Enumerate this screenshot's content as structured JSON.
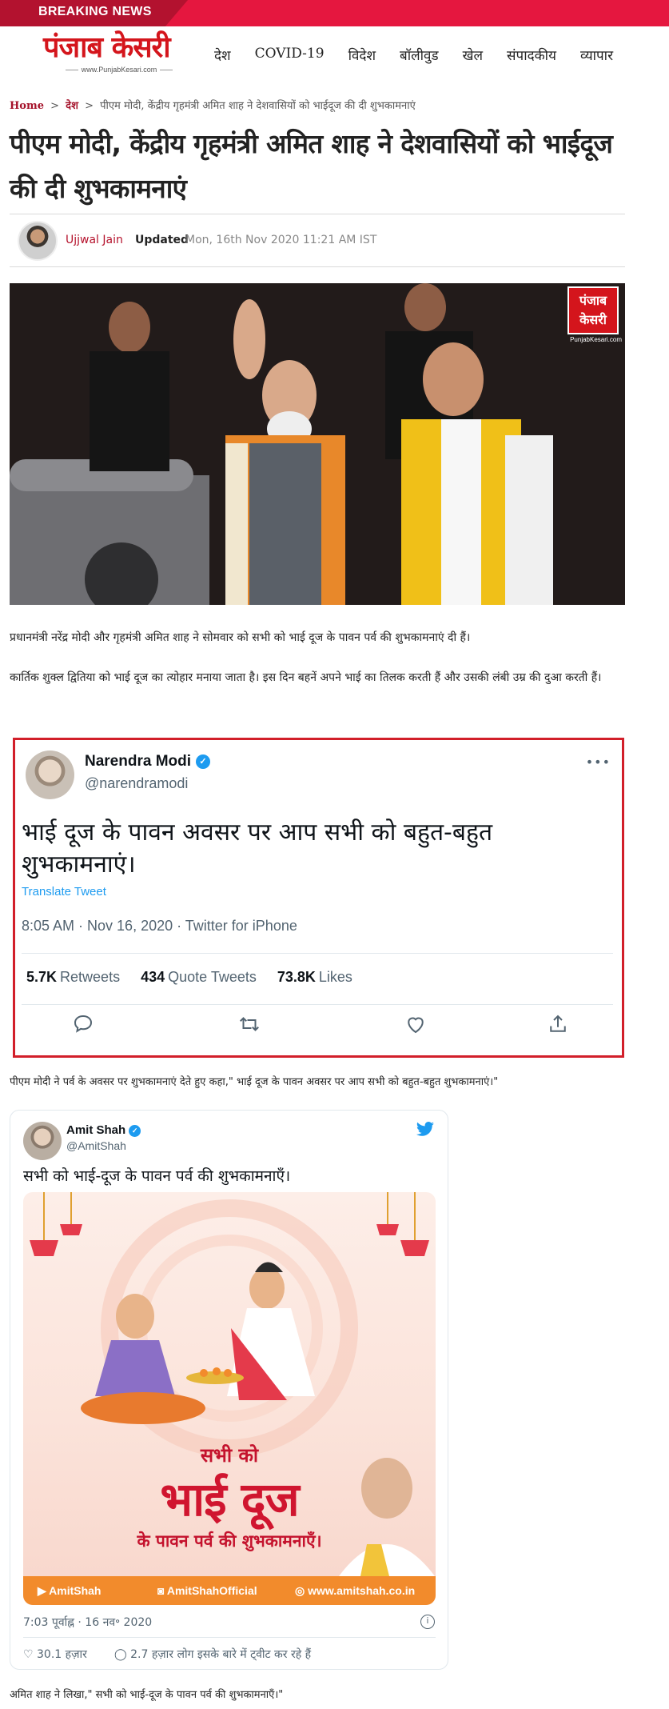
{
  "breaking": {
    "label": "BREAKING NEWS"
  },
  "header": {
    "logo_text": "पंजाब केसरी",
    "logo_sub": "www.PunjabKesari.com",
    "nav": [
      "देश",
      "COVID-19",
      "विदेश",
      "बॉलीवुड",
      "खेल",
      "संपादकीय",
      "व्यापार"
    ]
  },
  "breadcrumb": {
    "home": "Home",
    "section": "देश",
    "current": "पीएम मोदी, केंद्रीय गृहमंत्री अमित शाह ने देशवासियों को भाईदूज की दी शुभकामनाएं",
    "separator": ">"
  },
  "article": {
    "title": "पीएम मोदी, केंद्रीय गृहमंत्री अमित शाह ने देशवासियों को भाईदूज की दी शुभकामनाएं",
    "author": "Ujjwal Jain",
    "updated_label": "Updated",
    "updated_date": "Mon, 16th Nov 2020 11:21 AM IST",
    "hero_logo": "पंजाब केसरी",
    "hero_logo_sub": "PunjabKesari.com",
    "para1": "प्रधानमंत्री नरेंद्र मोदी और गृहमंत्री अमित शाह ने सोमवार को सभी को भाई दूज के पावन पर्व की शुभकामनाएं दी हैं।",
    "para2": "कार्तिक शुक्ल द्वितिया को भाई दूज का त्योहार मनाया जाता है। इस दिन बहनें अपने भाई का तिलक करती हैं और उसकी लंबी उम्र की दुआ करती हैं।",
    "caption1": "पीएम  मोदी ने पर्व के अवसर पर शुभकामनाएं देते हुए कहा,\" भाई दूज के पावन अवसर पर आप सभी को बहुत-बहुत शुभकामनाएं।\"",
    "caption2": "अमित शाह ने लिखा,\" सभी को भाई-दूज के पावन पर्व की शुभकामनाएँ।\""
  },
  "tweet_modi": {
    "name": "Narendra Modi",
    "handle": "@narendramodi",
    "verified_glyph": "✓",
    "more": "•••",
    "text": "भाई दूज के पावन अवसर पर आप सभी को बहुत-बहुत शुभकामनाएं।",
    "translate": "Translate Tweet",
    "meta": "8:05 AM · Nov 16, 2020 · Twitter for iPhone",
    "retweets_count": "5.7K",
    "retweets_label": "Retweets",
    "quotes_count": "434",
    "quotes_label": "Quote Tweets",
    "likes_count": "73.8K",
    "likes_label": "Likes",
    "actions": [
      "reply-icon",
      "retweet-icon",
      "like-icon",
      "share-icon"
    ]
  },
  "tweet_shah": {
    "name": "Amit Shah",
    "handle": "@AmitShah",
    "verified_glyph": "✓",
    "text": "सभी को भाई-दूज के पावन पर्व की शुभकामनाएँ।",
    "poster_line1": "सभी को",
    "poster_line2": "भाई दूज",
    "poster_line3": "के पावन पर्व की शुभकामनाएँ।",
    "poster_footer": [
      "AmitShah",
      "AmitShahOfficial",
      "www.amitshah.co.in"
    ],
    "time": "7:03 पूर्वाह्न · 16 नव॰ 2020",
    "info_glyph": "i",
    "likes": "30.1 हज़ार",
    "replies": "2.7 हज़ार लोग इसके बारे में ट्वीट कर रहे हैं"
  },
  "colors": {
    "brand_red": "#d4151c",
    "breaking_red": "#e5173f",
    "tweet_border_red": "#d21f2a",
    "twitter_blue": "#1d9bf0",
    "poster_orange": "#f28b2c"
  }
}
